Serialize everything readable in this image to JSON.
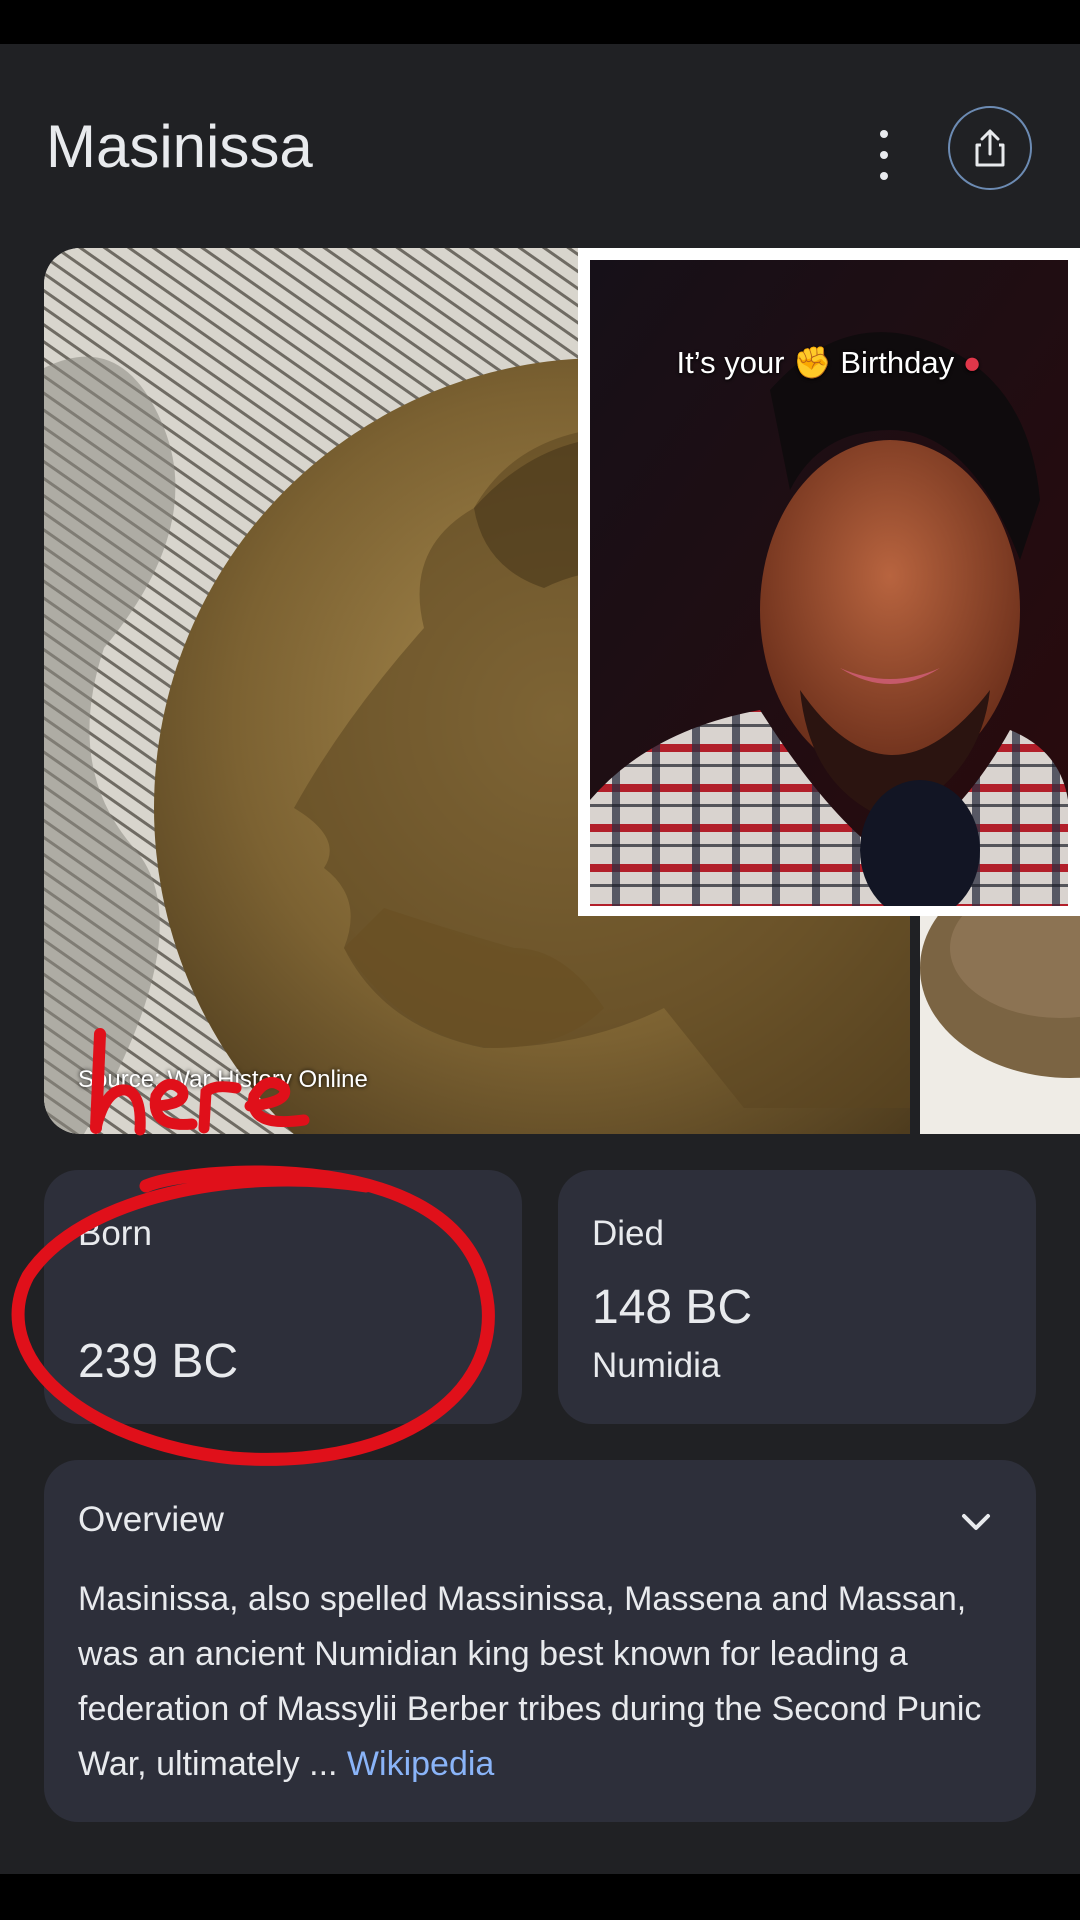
{
  "header": {
    "title": "Masinissa"
  },
  "gallery": {
    "source": "Source: War History Online"
  },
  "overlay": {
    "caption_before": "It’s your",
    "caption_after": "Birthday"
  },
  "annotation": {
    "text": "here",
    "color": "#e0101a"
  },
  "born": {
    "label": "Born",
    "year": "239 BC"
  },
  "died": {
    "label": "Died",
    "year": "148 BC",
    "place": "Numidia"
  },
  "overview": {
    "title": "Overview",
    "text": "Masinissa, also spelled Massinissa, Massena and Massan, was an ancient Numidian king best known for leading a federation of Massylii Berber tribes during the Second Punic War, ultimately ... ",
    "link": "Wikipedia"
  },
  "colors": {
    "background": "#202124",
    "card": "#2d2f3a",
    "link": "#8ab4f8",
    "share_ring": "#6c8bb3"
  },
  "icons": [
    "more-vert-icon",
    "share-icon",
    "chevron-down-icon"
  ]
}
